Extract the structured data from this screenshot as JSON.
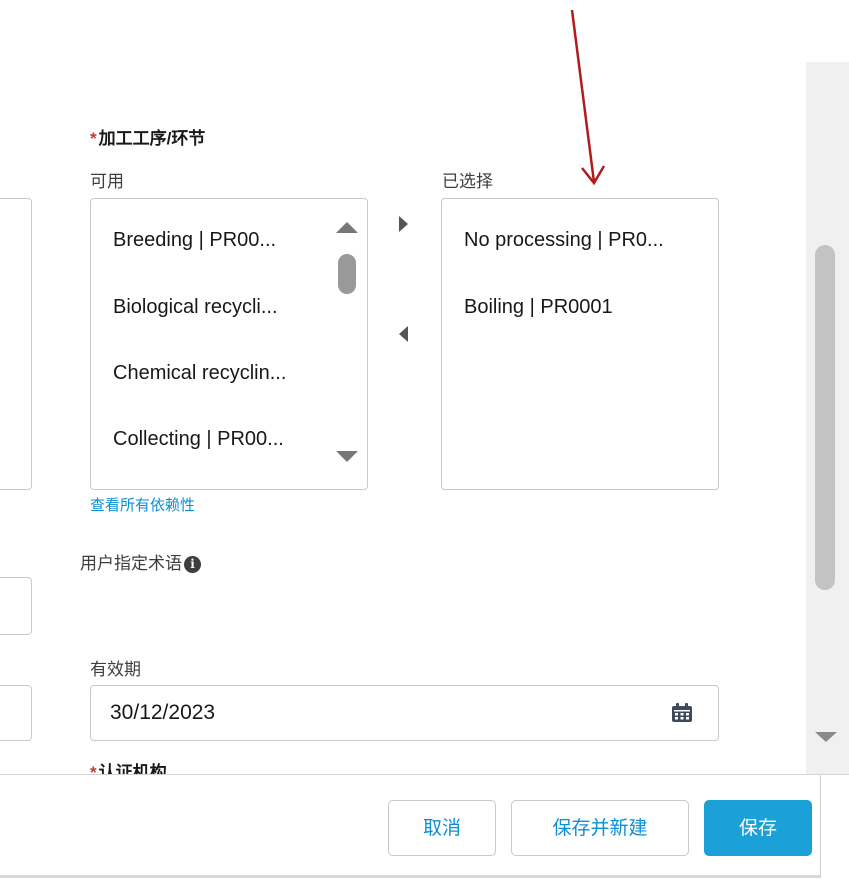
{
  "form": {
    "process_field": {
      "label": "加工工序/环节",
      "available_label": "可用",
      "selected_label": "已选择",
      "available_options": [
        "Breeding | PR00...",
        "Biological recycli...",
        "Chemical recyclin...",
        "Collecting | PR00..."
      ],
      "selected_options": [
        "No processing | PR0...",
        "Boiling | PR0001"
      ],
      "dependencies_link": "查看所有依赖性"
    },
    "user_term_field": {
      "label": "用户指定术语",
      "info_icon": "i"
    },
    "validity_field": {
      "label": "有效期",
      "value": "30/12/2023"
    },
    "cert_body_field": {
      "label": "认证机构"
    }
  },
  "footer": {
    "cancel_label": "取消",
    "save_new_label": "保存并新建",
    "save_label": "保存"
  },
  "colors": {
    "brand": "#1ba0d8",
    "link": "#0b8fd6",
    "required": "#c23934",
    "annotation_arrow": "#b01c1c"
  }
}
